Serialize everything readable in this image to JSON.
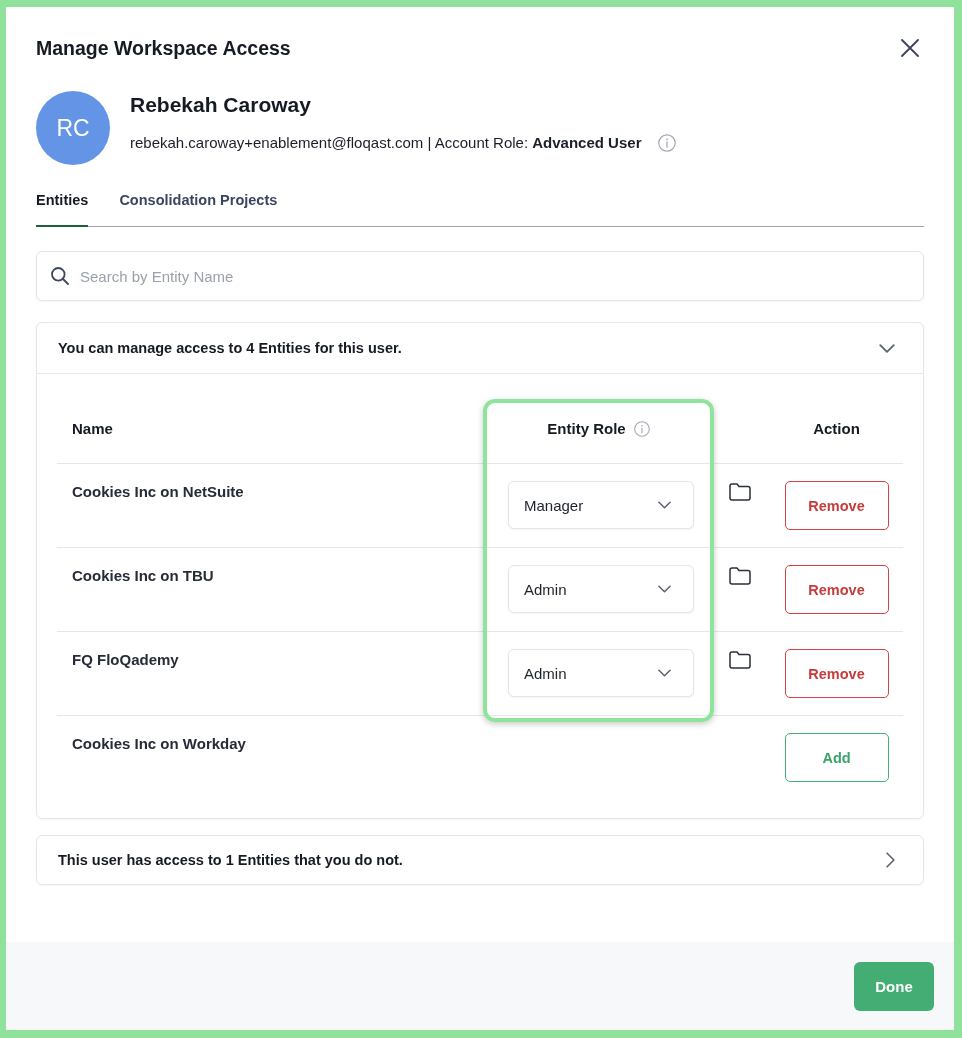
{
  "dialog": {
    "title": "Manage Workspace Access"
  },
  "user": {
    "initials": "RC",
    "name": "Rebekah Caroway",
    "details": "rebekah.caroway+enablement@floqast.com | Account Role: **Advanced User**"
  },
  "tabs": [
    {
      "label": "Entities",
      "selected": true
    },
    {
      "label": "Consolidation Projects",
      "selected": false
    }
  ],
  "search": {
    "placeholder": "Search by Entity Name"
  },
  "sections": [
    {
      "title": "You can manage access to 4 Entities for this user.",
      "expanded": true,
      "table": {
        "columns": [
          {
            "kind": "name",
            "label": "Name",
            "highlighted": false
          },
          {
            "kind": "role",
            "label": "Entity Role",
            "highlighted": true
          },
          {
            "kind": "action",
            "label": "Action",
            "highlighted": false
          }
        ],
        "rows": [
          {
            "name": "Cookies Inc on NetSuite",
            "role": "Manager",
            "action": {
              "kind": "remove",
              "label": "Remove"
            }
          },
          {
            "name": "Cookies Inc on TBU",
            "role": "Admin",
            "action": {
              "kind": "remove",
              "label": "Remove"
            }
          },
          {
            "name": "FQ FloQademy",
            "role": "Admin",
            "action": {
              "kind": "remove",
              "label": "Remove"
            }
          },
          {
            "name": "Cookies Inc on Workday",
            "action": {
              "kind": "add",
              "label": "Add"
            }
          }
        ]
      }
    },
    {
      "title": "This user has access to 1 Entities that you do not.",
      "expanded": false
    }
  ],
  "footer": {
    "done": "Done"
  }
}
